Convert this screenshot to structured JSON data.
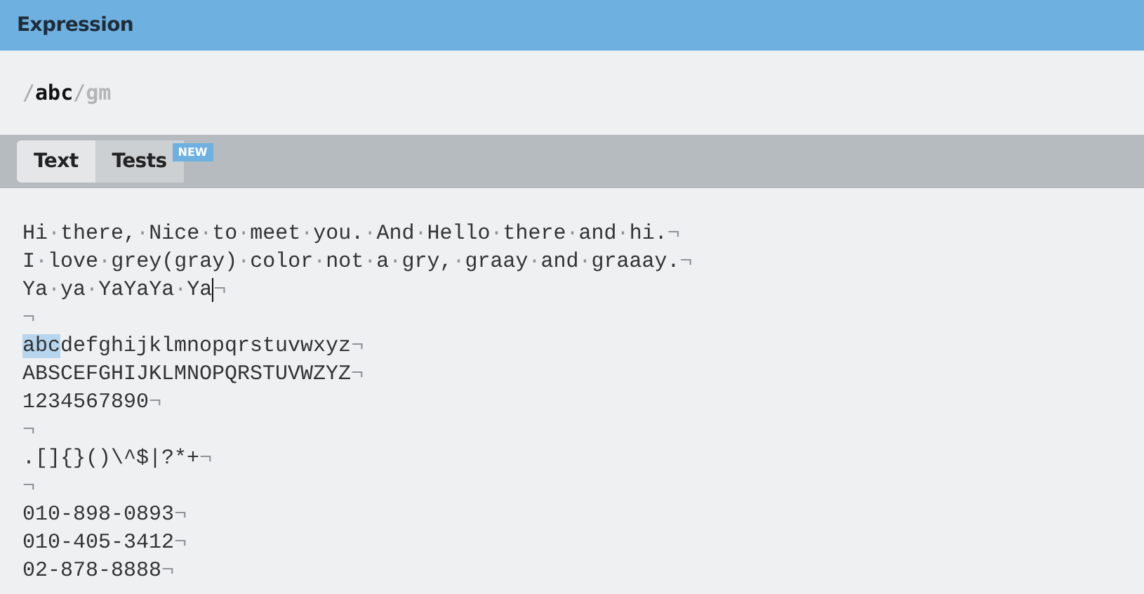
{
  "header": {
    "title": "Expression"
  },
  "expression": {
    "open": "/",
    "pattern": "abc",
    "close": "/",
    "flags": "gm"
  },
  "tabs": [
    {
      "label": "Text",
      "selected": true
    },
    {
      "label": "Tests",
      "selected": false,
      "badge": "NEW"
    }
  ],
  "editor": {
    "lines": [
      {
        "cursor": false,
        "segments": [
          {
            "kind": "word",
            "text": "Hi"
          },
          {
            "kind": "space",
            "text": "·"
          },
          {
            "kind": "word",
            "text": "there,"
          },
          {
            "kind": "space",
            "text": "·"
          },
          {
            "kind": "word",
            "text": "Nice"
          },
          {
            "kind": "space",
            "text": "·"
          },
          {
            "kind": "word",
            "text": "to"
          },
          {
            "kind": "space",
            "text": "·"
          },
          {
            "kind": "word",
            "text": "meet"
          },
          {
            "kind": "space",
            "text": "·"
          },
          {
            "kind": "word",
            "text": "you."
          },
          {
            "kind": "space",
            "text": "·"
          },
          {
            "kind": "word",
            "text": "And"
          },
          {
            "kind": "space",
            "text": "·"
          },
          {
            "kind": "word",
            "text": "Hello"
          },
          {
            "kind": "space",
            "text": "·"
          },
          {
            "kind": "word",
            "text": "there"
          },
          {
            "kind": "space",
            "text": "·"
          },
          {
            "kind": "word",
            "text": "and"
          },
          {
            "kind": "space",
            "text": "·"
          },
          {
            "kind": "word",
            "text": "hi."
          },
          {
            "kind": "eol",
            "text": "¬"
          }
        ]
      },
      {
        "cursor": false,
        "segments": [
          {
            "kind": "word",
            "text": "I"
          },
          {
            "kind": "space",
            "text": "·"
          },
          {
            "kind": "word",
            "text": "love"
          },
          {
            "kind": "space",
            "text": "·"
          },
          {
            "kind": "word",
            "text": "grey(gray)"
          },
          {
            "kind": "space",
            "text": "·"
          },
          {
            "kind": "word",
            "text": "color"
          },
          {
            "kind": "space",
            "text": "·"
          },
          {
            "kind": "word",
            "text": "not"
          },
          {
            "kind": "space",
            "text": "·"
          },
          {
            "kind": "word",
            "text": "a"
          },
          {
            "kind": "space",
            "text": "·"
          },
          {
            "kind": "word",
            "text": "gry,"
          },
          {
            "kind": "space",
            "text": "·"
          },
          {
            "kind": "word",
            "text": "graay"
          },
          {
            "kind": "space",
            "text": "·"
          },
          {
            "kind": "word",
            "text": "and"
          },
          {
            "kind": "space",
            "text": "·"
          },
          {
            "kind": "word",
            "text": "graaay."
          },
          {
            "kind": "eol",
            "text": "¬"
          }
        ]
      },
      {
        "cursor": true,
        "segments": [
          {
            "kind": "word",
            "text": "Ya"
          },
          {
            "kind": "space",
            "text": "·"
          },
          {
            "kind": "word",
            "text": "ya"
          },
          {
            "kind": "space",
            "text": "·"
          },
          {
            "kind": "word",
            "text": "YaYaYa"
          },
          {
            "kind": "space",
            "text": "·"
          },
          {
            "kind": "word",
            "text": "Ya"
          },
          {
            "kind": "eol",
            "text": "¬"
          }
        ]
      },
      {
        "cursor": false,
        "segments": [
          {
            "kind": "eol",
            "text": "¬"
          }
        ]
      },
      {
        "cursor": false,
        "segments": [
          {
            "kind": "match",
            "text": "abc"
          },
          {
            "kind": "word",
            "text": "defghijklmnopqrstuvwxyz"
          },
          {
            "kind": "eol",
            "text": "¬"
          }
        ]
      },
      {
        "cursor": false,
        "segments": [
          {
            "kind": "word",
            "text": "ABSCEFGHIJKLMNOPQRSTUVWZYZ"
          },
          {
            "kind": "eol",
            "text": "¬"
          }
        ]
      },
      {
        "cursor": false,
        "segments": [
          {
            "kind": "word",
            "text": "1234567890"
          },
          {
            "kind": "eol",
            "text": "¬"
          }
        ]
      },
      {
        "cursor": false,
        "segments": [
          {
            "kind": "eol",
            "text": "¬"
          }
        ]
      },
      {
        "cursor": false,
        "segments": [
          {
            "kind": "word",
            "text": ".[]{}()\\^$|?*+"
          },
          {
            "kind": "eol",
            "text": "¬"
          }
        ]
      },
      {
        "cursor": false,
        "segments": [
          {
            "kind": "eol",
            "text": "¬"
          }
        ]
      },
      {
        "cursor": false,
        "segments": [
          {
            "kind": "word",
            "text": "010-898-0893"
          },
          {
            "kind": "eol",
            "text": "¬"
          }
        ]
      },
      {
        "cursor": false,
        "segments": [
          {
            "kind": "word",
            "text": "010-405-3412"
          },
          {
            "kind": "eol",
            "text": "¬"
          }
        ]
      },
      {
        "cursor": false,
        "segments": [
          {
            "kind": "word",
            "text": "02-878-8888"
          },
          {
            "kind": "eol",
            "text": "¬"
          }
        ]
      }
    ]
  }
}
